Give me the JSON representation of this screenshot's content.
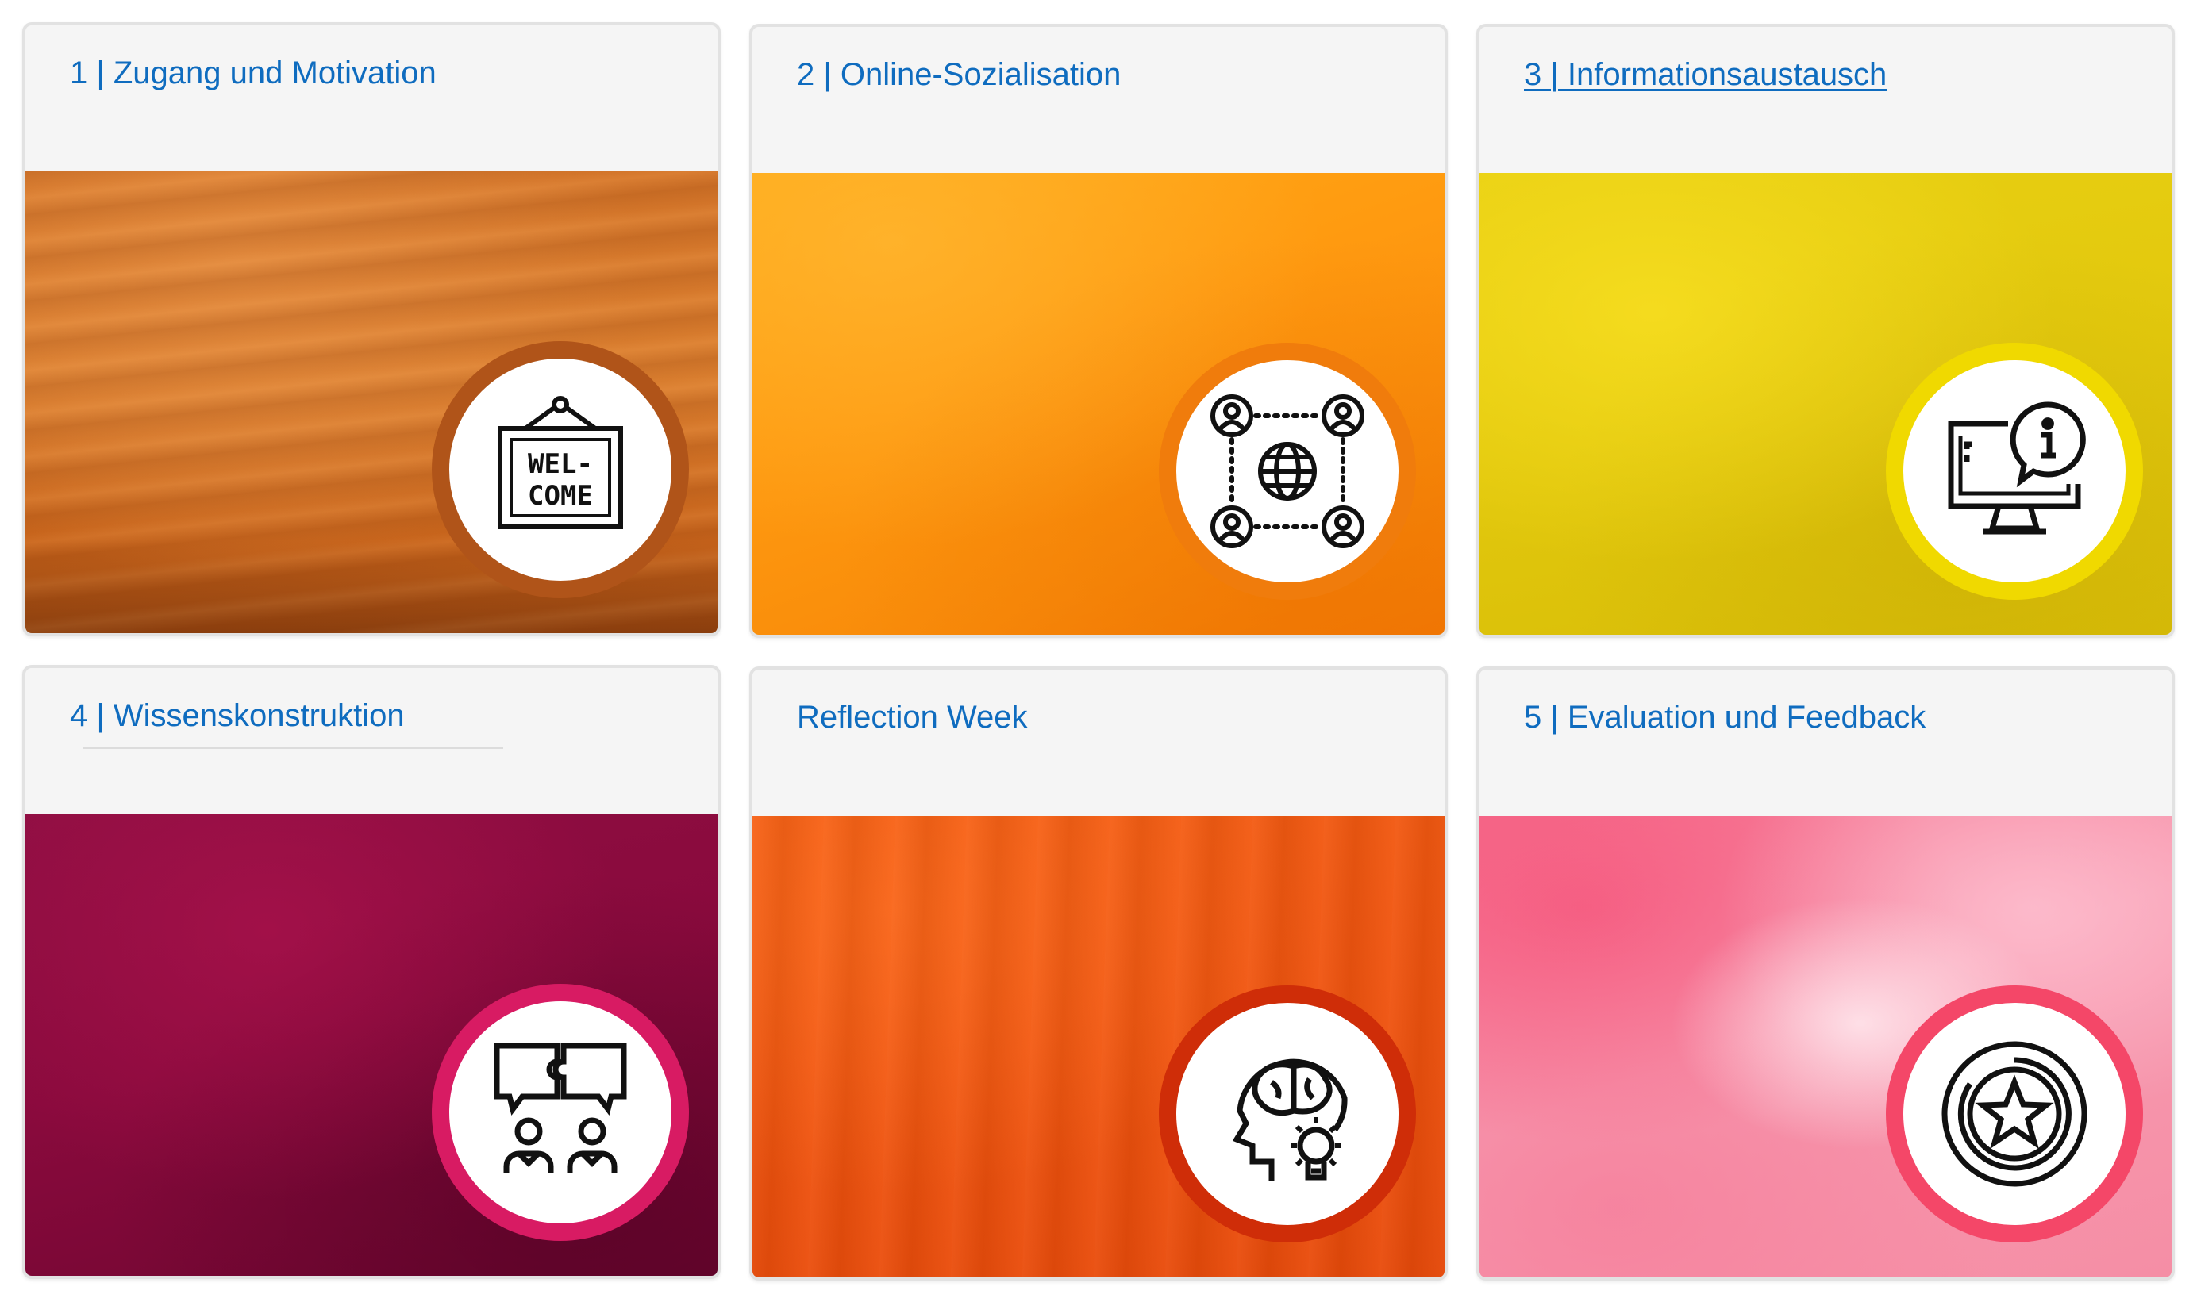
{
  "tiles": [
    {
      "title": "1 | Zugang und Motivation",
      "icon": "welcome-sign-icon",
      "color_main": "#d9772a",
      "ring": "#b05419"
    },
    {
      "title": "2 | Online-Sozialisation",
      "icon": "people-network-globe-icon",
      "color_main": "#ff9c13",
      "ring": "#f07c0c"
    },
    {
      "title": "3 | Informationsaustausch",
      "icon": "monitor-info-icon",
      "color_main": "#e3cb0c",
      "ring": "#f0d900"
    },
    {
      "title": "4 | Wissenskonstruktion",
      "icon": "collaboration-puzzle-icon",
      "color_main": "#8a0a3d",
      "ring": "#d81b63"
    },
    {
      "title": "Reflection Week",
      "icon": "head-brain-idea-icon",
      "color_main": "#f0540f",
      "ring": "#cf2d08"
    },
    {
      "title": "5 | Evaluation und Feedback",
      "icon": "star-medal-icon",
      "color_main": "#f58ea5",
      "ring": "#f44768"
    }
  ]
}
